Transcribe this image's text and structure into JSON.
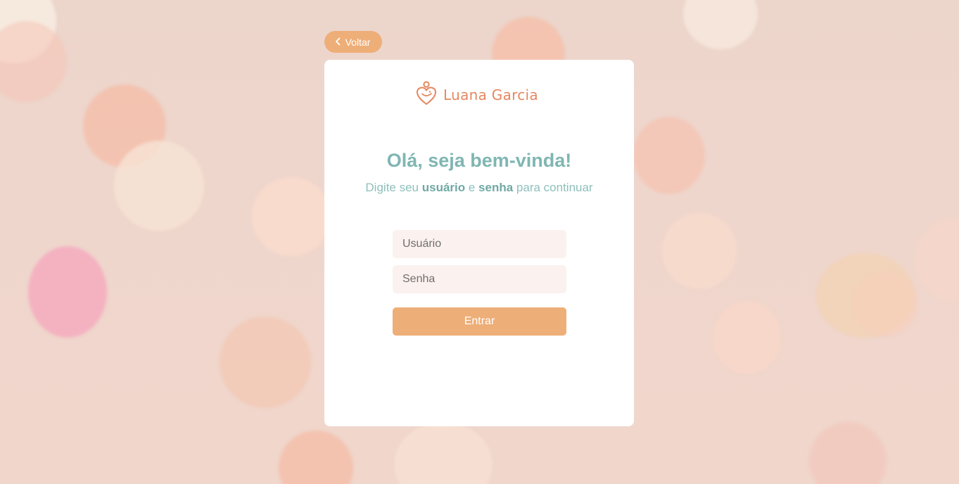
{
  "colors": {
    "accent": "#eeae78",
    "brand": "#e5875f",
    "heading": "#7fb6b2",
    "input_bg": "#fbf1ee"
  },
  "back_button": {
    "label": "Voltar",
    "icon": "chevron-left-icon"
  },
  "logo": {
    "icon": "heart-person-icon",
    "text": "Luana Garcia"
  },
  "login": {
    "title": "Olá, seja bem-vinda!",
    "subtitle_parts": {
      "p1": "Digite seu ",
      "b1": "usuário",
      "p2": " e ",
      "b2": "senha",
      "p3": " para continuar"
    },
    "username_placeholder": "Usuário",
    "password_placeholder": "Senha",
    "submit_label": "Entrar"
  }
}
